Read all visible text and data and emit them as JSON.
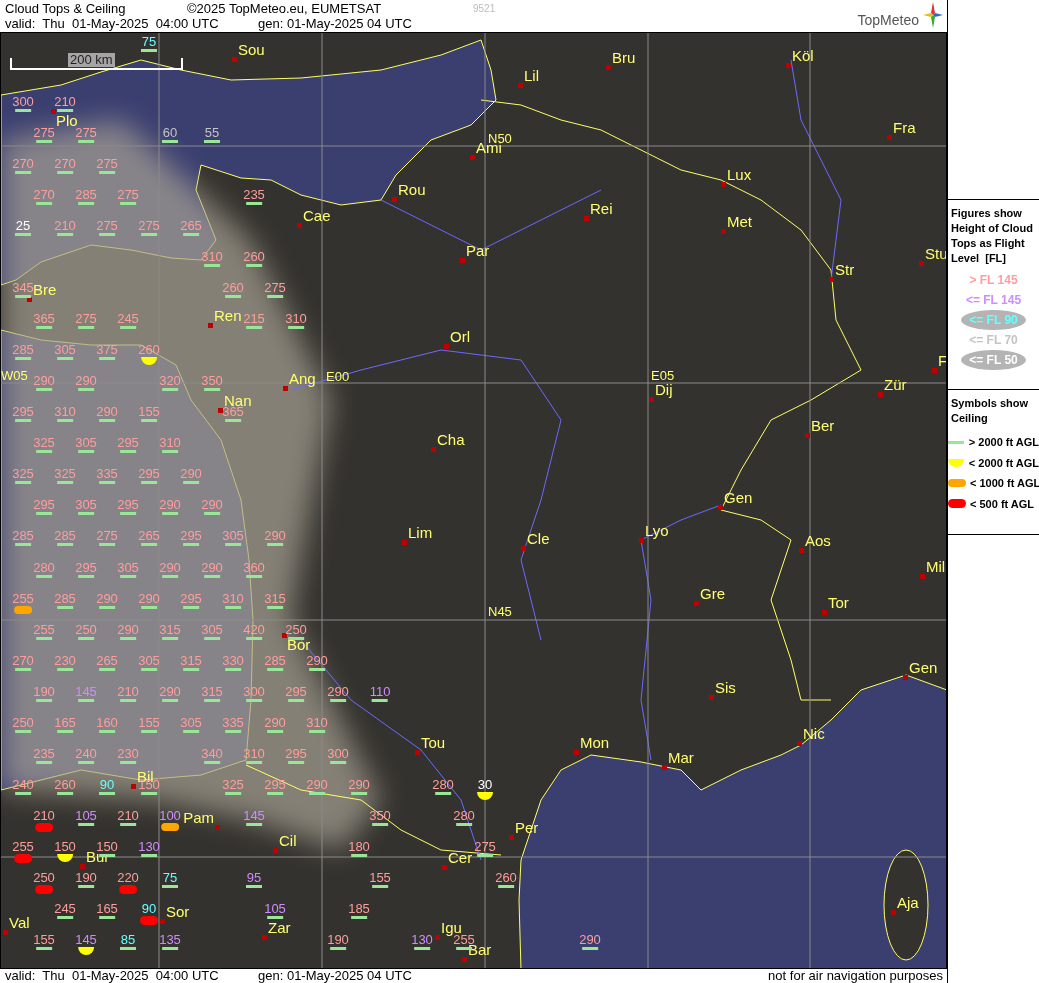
{
  "header": {
    "title": "Cloud Tops & Ceiling",
    "copyright": "©2025 TopMeteo.eu, EUMETSAT",
    "code": "9521",
    "valid": "valid:  Thu  01-May-2025  04:00 UTC",
    "generated": "gen: 01-May-2025 04 UTC"
  },
  "logo": {
    "text": "TopMeteo"
  },
  "map": {
    "scale": "200 km",
    "places": [
      {
        "name": "Sou",
        "kind": "city"
      },
      {
        "name": "Bru",
        "kind": "city"
      },
      {
        "name": "Köl",
        "kind": "city"
      },
      {
        "name": "Lil",
        "kind": "city"
      },
      {
        "name": "Plo",
        "kind": "city"
      },
      {
        "name": "N50",
        "kind": "graticule"
      },
      {
        "name": "Ami",
        "kind": "city"
      },
      {
        "name": "Fra",
        "kind": "city"
      },
      {
        "name": "Lux",
        "kind": "city"
      },
      {
        "name": "Rou",
        "kind": "city"
      },
      {
        "name": "Cae",
        "kind": "city"
      },
      {
        "name": "Rei",
        "kind": "city"
      },
      {
        "name": "Met",
        "kind": "city"
      },
      {
        "name": "Par",
        "kind": "city"
      },
      {
        "name": "Stu",
        "kind": "city"
      },
      {
        "name": "Str",
        "kind": "city"
      },
      {
        "name": "Bre",
        "kind": "city"
      },
      {
        "name": "Ren",
        "kind": "city"
      },
      {
        "name": "Orl",
        "kind": "city"
      },
      {
        "name": "F",
        "kind": "city"
      },
      {
        "name": "W05",
        "kind": "graticule"
      },
      {
        "name": "Ang",
        "kind": "city"
      },
      {
        "name": "E00",
        "kind": "graticule"
      },
      {
        "name": "E05",
        "kind": "graticule"
      },
      {
        "name": "Dij",
        "kind": "city"
      },
      {
        "name": "Zür",
        "kind": "city"
      },
      {
        "name": "Nan",
        "kind": "city"
      },
      {
        "name": "Ber",
        "kind": "city"
      },
      {
        "name": "Cha",
        "kind": "city"
      },
      {
        "name": "Gen",
        "kind": "city"
      },
      {
        "name": "Lim",
        "kind": "city"
      },
      {
        "name": "Lyo",
        "kind": "city"
      },
      {
        "name": "Cle",
        "kind": "city"
      },
      {
        "name": "Aos",
        "kind": "city"
      },
      {
        "name": "Mil",
        "kind": "city"
      },
      {
        "name": "Gre",
        "kind": "city"
      },
      {
        "name": "Tor",
        "kind": "city"
      },
      {
        "name": "N45",
        "kind": "graticule"
      },
      {
        "name": "Bor",
        "kind": "city"
      },
      {
        "name": "Gen",
        "kind": "city"
      },
      {
        "name": "Sis",
        "kind": "city"
      },
      {
        "name": "Nic",
        "kind": "city"
      },
      {
        "name": "Tou",
        "kind": "city"
      },
      {
        "name": "Mon",
        "kind": "city"
      },
      {
        "name": "Mar",
        "kind": "city"
      },
      {
        "name": "Bil",
        "kind": "city"
      },
      {
        "name": "Pam",
        "kind": "city"
      },
      {
        "name": "Per",
        "kind": "city"
      },
      {
        "name": "Cil",
        "kind": "city"
      },
      {
        "name": "Cer",
        "kind": "city"
      },
      {
        "name": "Bur",
        "kind": "city"
      },
      {
        "name": "Aja",
        "kind": "city"
      },
      {
        "name": "Sor",
        "kind": "city"
      },
      {
        "name": "Val",
        "kind": "city"
      },
      {
        "name": "Zar",
        "kind": "city"
      },
      {
        "name": "Igu",
        "kind": "city"
      },
      {
        "name": "Bar",
        "kind": "city"
      }
    ],
    "figures": [
      {
        "value": "75",
        "color": "#66ffff",
        "kind": "above2000"
      },
      {
        "value": "300",
        "color": "#ff9d9d",
        "kind": "above2000"
      },
      {
        "value": "210",
        "color": "#ff9d9d",
        "kind": "above2000"
      },
      {
        "value": "275",
        "color": "#ff9d9d",
        "kind": "above2000"
      },
      {
        "value": "275",
        "color": "#ff9d9d",
        "kind": "above2000"
      },
      {
        "value": "60",
        "color": "#c4c4c4",
        "kind": "above2000"
      },
      {
        "value": "55",
        "color": "#c4c4c4",
        "kind": "above2000"
      },
      {
        "value": "270",
        "color": "#ff9d9d",
        "kind": "above2000"
      },
      {
        "value": "270",
        "color": "#ff9d9d",
        "kind": "above2000"
      },
      {
        "value": "275",
        "color": "#ff9d9d",
        "kind": "above2000"
      },
      {
        "value": "270",
        "color": "#ff9d9d",
        "kind": "above2000"
      },
      {
        "value": "285",
        "color": "#ff9d9d",
        "kind": "above2000"
      },
      {
        "value": "275",
        "color": "#ff9d9d",
        "kind": "above2000"
      },
      {
        "value": "235",
        "color": "#ff9d9d",
        "kind": "above2000"
      },
      {
        "value": "25",
        "color": "#ffffff",
        "kind": "above2000"
      },
      {
        "value": "210",
        "color": "#ff9d9d",
        "kind": "above2000"
      },
      {
        "value": "275",
        "color": "#ff9d9d",
        "kind": "above2000"
      },
      {
        "value": "275",
        "color": "#ff9d9d",
        "kind": "above2000"
      },
      {
        "value": "265",
        "color": "#ff9d9d",
        "kind": "above2000"
      },
      {
        "value": "310",
        "color": "#ff9d9d",
        "kind": "above2000"
      },
      {
        "value": "260",
        "color": "#ff9d9d",
        "kind": "above2000"
      },
      {
        "value": "345",
        "color": "#ff9d9d",
        "kind": "above2000"
      },
      {
        "value": "260",
        "color": "#ff9d9d",
        "kind": "above2000"
      },
      {
        "value": "275",
        "color": "#ff9d9d",
        "kind": "above2000"
      },
      {
        "value": "365",
        "color": "#ff9d9d",
        "kind": "above2000"
      },
      {
        "value": "275",
        "color": "#ff9d9d",
        "kind": "above2000"
      },
      {
        "value": "245",
        "color": "#ff9d9d",
        "kind": "above2000"
      },
      {
        "value": "215",
        "color": "#ff9d9d",
        "kind": "above2000"
      },
      {
        "value": "310",
        "color": "#ff9d9d",
        "kind": "above2000"
      },
      {
        "value": "285",
        "color": "#ff9d9d",
        "kind": "above2000"
      },
      {
        "value": "305",
        "color": "#ff9d9d",
        "kind": "above2000"
      },
      {
        "value": "375",
        "color": "#ff9d9d",
        "kind": "above2000"
      },
      {
        "value": "260",
        "color": "#ff9d9d",
        "kind": "below2000"
      },
      {
        "value": "290",
        "color": "#ff9d9d",
        "kind": "above2000"
      },
      {
        "value": "290",
        "color": "#ff9d9d",
        "kind": "above2000"
      },
      {
        "value": "320",
        "color": "#ff9d9d",
        "kind": "above2000"
      },
      {
        "value": "350",
        "color": "#ff9d9d",
        "kind": "above2000"
      },
      {
        "value": "295",
        "color": "#ff9d9d",
        "kind": "above2000"
      },
      {
        "value": "310",
        "color": "#ff9d9d",
        "kind": "above2000"
      },
      {
        "value": "290",
        "color": "#ff9d9d",
        "kind": "above2000"
      },
      {
        "value": "155",
        "color": "#ff9d9d",
        "kind": "above2000"
      },
      {
        "value": "365",
        "color": "#ff9d9d",
        "kind": "above2000"
      },
      {
        "value": "325",
        "color": "#ff9d9d",
        "kind": "above2000"
      },
      {
        "value": "305",
        "color": "#ff9d9d",
        "kind": "above2000"
      },
      {
        "value": "295",
        "color": "#ff9d9d",
        "kind": "above2000"
      },
      {
        "value": "310",
        "color": "#ff9d9d",
        "kind": "above2000"
      },
      {
        "value": "325",
        "color": "#ff9d9d",
        "kind": "above2000"
      },
      {
        "value": "325",
        "color": "#ff9d9d",
        "kind": "above2000"
      },
      {
        "value": "335",
        "color": "#ff9d9d",
        "kind": "above2000"
      },
      {
        "value": "295",
        "color": "#ff9d9d",
        "kind": "above2000"
      },
      {
        "value": "290",
        "color": "#ff9d9d",
        "kind": "above2000"
      },
      {
        "value": "295",
        "color": "#ff9d9d",
        "kind": "above2000"
      },
      {
        "value": "305",
        "color": "#ff9d9d",
        "kind": "above2000"
      },
      {
        "value": "295",
        "color": "#ff9d9d",
        "kind": "above2000"
      },
      {
        "value": "290",
        "color": "#ff9d9d",
        "kind": "above2000"
      },
      {
        "value": "290",
        "color": "#ff9d9d",
        "kind": "above2000"
      },
      {
        "value": "285",
        "color": "#ff9d9d",
        "kind": "above2000"
      },
      {
        "value": "285",
        "color": "#ff9d9d",
        "kind": "above2000"
      },
      {
        "value": "275",
        "color": "#ff9d9d",
        "kind": "above2000"
      },
      {
        "value": "265",
        "color": "#ff9d9d",
        "kind": "above2000"
      },
      {
        "value": "295",
        "color": "#ff9d9d",
        "kind": "above2000"
      },
      {
        "value": "305",
        "color": "#ff9d9d",
        "kind": "above2000"
      },
      {
        "value": "290",
        "color": "#ff9d9d",
        "kind": "above2000"
      },
      {
        "value": "280",
        "color": "#ff9d9d",
        "kind": "above2000"
      },
      {
        "value": "295",
        "color": "#ff9d9d",
        "kind": "above2000"
      },
      {
        "value": "305",
        "color": "#ff9d9d",
        "kind": "above2000"
      },
      {
        "value": "290",
        "color": "#ff9d9d",
        "kind": "above2000"
      },
      {
        "value": "290",
        "color": "#ff9d9d",
        "kind": "above2000"
      },
      {
        "value": "360",
        "color": "#ff9d9d",
        "kind": "above2000"
      },
      {
        "value": "255",
        "color": "#ff9d9d",
        "kind": "below1000"
      },
      {
        "value": "285",
        "color": "#ff9d9d",
        "kind": "above2000"
      },
      {
        "value": "290",
        "color": "#ff9d9d",
        "kind": "above2000"
      },
      {
        "value": "290",
        "color": "#ff9d9d",
        "kind": "above2000"
      },
      {
        "value": "295",
        "color": "#ff9d9d",
        "kind": "above2000"
      },
      {
        "value": "310",
        "color": "#ff9d9d",
        "kind": "above2000"
      },
      {
        "value": "315",
        "color": "#ff9d9d",
        "kind": "above2000"
      },
      {
        "value": "255",
        "color": "#ff9d9d",
        "kind": "above2000"
      },
      {
        "value": "250",
        "color": "#ff9d9d",
        "kind": "above2000"
      },
      {
        "value": "290",
        "color": "#ff9d9d",
        "kind": "above2000"
      },
      {
        "value": "315",
        "color": "#ff9d9d",
        "kind": "above2000"
      },
      {
        "value": "305",
        "color": "#ff9d9d",
        "kind": "above2000"
      },
      {
        "value": "420",
        "color": "#ff9d9d",
        "kind": "above2000"
      },
      {
        "value": "250",
        "color": "#ff9d9d",
        "kind": "above2000"
      },
      {
        "value": "270",
        "color": "#ff9d9d",
        "kind": "above2000"
      },
      {
        "value": "230",
        "color": "#ff9d9d",
        "kind": "above2000"
      },
      {
        "value": "265",
        "color": "#ff9d9d",
        "kind": "above2000"
      },
      {
        "value": "305",
        "color": "#ff9d9d",
        "kind": "above2000"
      },
      {
        "value": "315",
        "color": "#ff9d9d",
        "kind": "above2000"
      },
      {
        "value": "330",
        "color": "#ff9d9d",
        "kind": "above2000"
      },
      {
        "value": "285",
        "color": "#ff9d9d",
        "kind": "above2000"
      },
      {
        "value": "290",
        "color": "#ff9d9d",
        "kind": "above2000"
      },
      {
        "value": "190",
        "color": "#ff9d9d",
        "kind": "above2000"
      },
      {
        "value": "145",
        "color": "#cf8cff",
        "kind": "above2000"
      },
      {
        "value": "210",
        "color": "#ff9d9d",
        "kind": "above2000"
      },
      {
        "value": "290",
        "color": "#ff9d9d",
        "kind": "above2000"
      },
      {
        "value": "315",
        "color": "#ff9d9d",
        "kind": "above2000"
      },
      {
        "value": "300",
        "color": "#ff9d9d",
        "kind": "above2000"
      },
      {
        "value": "295",
        "color": "#ff9d9d",
        "kind": "above2000"
      },
      {
        "value": "290",
        "color": "#ff9d9d",
        "kind": "above2000"
      },
      {
        "value": "110",
        "color": "#cf8cff",
        "kind": "above2000"
      },
      {
        "value": "250",
        "color": "#ff9d9d",
        "kind": "above2000"
      },
      {
        "value": "165",
        "color": "#ff9d9d",
        "kind": "above2000"
      },
      {
        "value": "160",
        "color": "#ff9d9d",
        "kind": "above2000"
      },
      {
        "value": "155",
        "color": "#ff9d9d",
        "kind": "above2000"
      },
      {
        "value": "305",
        "color": "#ff9d9d",
        "kind": "above2000"
      },
      {
        "value": "335",
        "color": "#ff9d9d",
        "kind": "above2000"
      },
      {
        "value": "290",
        "color": "#ff9d9d",
        "kind": "above2000"
      },
      {
        "value": "310",
        "color": "#ff9d9d",
        "kind": "above2000"
      },
      {
        "value": "235",
        "color": "#ff9d9d",
        "kind": "above2000"
      },
      {
        "value": "240",
        "color": "#ff9d9d",
        "kind": "above2000"
      },
      {
        "value": "230",
        "color": "#ff9d9d",
        "kind": "above2000"
      },
      {
        "value": "340",
        "color": "#ff9d9d",
        "kind": "above2000"
      },
      {
        "value": "310",
        "color": "#ff9d9d",
        "kind": "above2000"
      },
      {
        "value": "295",
        "color": "#ff9d9d",
        "kind": "above2000"
      },
      {
        "value": "300",
        "color": "#ff9d9d",
        "kind": "above2000"
      },
      {
        "value": "240",
        "color": "#ff9d9d",
        "kind": "above2000"
      },
      {
        "value": "260",
        "color": "#ff9d9d",
        "kind": "above2000"
      },
      {
        "value": "90",
        "color": "#66ffff",
        "kind": "above2000"
      },
      {
        "value": "150",
        "color": "#ff9d9d",
        "kind": "above2000"
      },
      {
        "value": "325",
        "color": "#ff9d9d",
        "kind": "above2000"
      },
      {
        "value": "295",
        "color": "#ff9d9d",
        "kind": "above2000"
      },
      {
        "value": "290",
        "color": "#ff9d9d",
        "kind": "above2000"
      },
      {
        "value": "290",
        "color": "#ff9d9d",
        "kind": "above2000"
      },
      {
        "value": "280",
        "color": "#ff9d9d",
        "kind": "above2000"
      },
      {
        "value": "30",
        "color": "#ffffff",
        "kind": "below2000"
      },
      {
        "value": "210",
        "color": "#ff9d9d",
        "kind": "below500"
      },
      {
        "value": "105",
        "color": "#cf8cff",
        "kind": "above2000"
      },
      {
        "value": "210",
        "color": "#ff9d9d",
        "kind": "above2000"
      },
      {
        "value": "100",
        "color": "#cf8cff",
        "kind": "below1000"
      },
      {
        "value": "145",
        "color": "#cf8cff",
        "kind": "above2000"
      },
      {
        "value": "350",
        "color": "#ff9d9d",
        "kind": "above2000"
      },
      {
        "value": "280",
        "color": "#ff9d9d",
        "kind": "above2000"
      },
      {
        "value": "255",
        "color": "#ff9d9d",
        "kind": "below500"
      },
      {
        "value": "150",
        "color": "#ff9d9d",
        "kind": "below2000"
      },
      {
        "value": "150",
        "color": "#ff9d9d",
        "kind": "above2000"
      },
      {
        "value": "130",
        "color": "#cf8cff",
        "kind": "above2000"
      },
      {
        "value": "180",
        "color": "#ff9d9d",
        "kind": "above2000"
      },
      {
        "value": "275",
        "color": "#ff9d9d",
        "kind": "above2000"
      },
      {
        "value": "250",
        "color": "#ff9d9d",
        "kind": "below500"
      },
      {
        "value": "190",
        "color": "#ff9d9d",
        "kind": "above2000"
      },
      {
        "value": "220",
        "color": "#ff9d9d",
        "kind": "below500"
      },
      {
        "value": "75",
        "color": "#66ffff",
        "kind": "above2000"
      },
      {
        "value": "95",
        "color": "#cf8cff",
        "kind": "above2000"
      },
      {
        "value": "155",
        "color": "#ff9d9d",
        "kind": "above2000"
      },
      {
        "value": "260",
        "color": "#ff9d9d",
        "kind": "above2000"
      },
      {
        "value": "245",
        "color": "#ff9d9d",
        "kind": "above2000"
      },
      {
        "value": "165",
        "color": "#ff9d9d",
        "kind": "above2000"
      },
      {
        "value": "90",
        "color": "#66ffff",
        "kind": "below500"
      },
      {
        "value": "105",
        "color": "#cf8cff",
        "kind": "above2000"
      },
      {
        "value": "185",
        "color": "#ff9d9d",
        "kind": "above2000"
      },
      {
        "value": "155",
        "color": "#ff9d9d",
        "kind": "above2000"
      },
      {
        "value": "145",
        "color": "#cf8cff",
        "kind": "below2000"
      },
      {
        "value": "85",
        "color": "#66ffff",
        "kind": "above2000"
      },
      {
        "value": "135",
        "color": "#cf8cff",
        "kind": "above2000"
      },
      {
        "value": "190",
        "color": "#ff9d9d",
        "kind": "above2000"
      },
      {
        "value": "130",
        "color": "#cf8cff",
        "kind": "above2000"
      },
      {
        "value": "255",
        "color": "#ff9d9d",
        "kind": "above2000"
      },
      {
        "value": "290",
        "color": "#ff9d9d",
        "kind": "above2000"
      }
    ]
  },
  "legend": {
    "figures_title": "Figures show Height of Cloud Tops as Flight Level  [FL]",
    "tiers": [
      {
        "label": "> FL 145",
        "color": "#ff9d9d",
        "ellipse": false
      },
      {
        "label": "<= FL 145",
        "color": "#cf8cff",
        "ellipse": false
      },
      {
        "label": "<= FL 90",
        "color": "#66ffff",
        "ellipse": true
      },
      {
        "label": "<= FL 70",
        "color": "#c4c4c4",
        "ellipse": false
      },
      {
        "label": "<= FL 50",
        "color": "#ffffff",
        "ellipse": true
      }
    ],
    "ceiling_title": "Symbols show Ceiling",
    "ceilings": [
      {
        "label": "> 2000 ft AGL",
        "kind": "above2000"
      },
      {
        "label": "< 2000 ft AGL",
        "kind": "below2000"
      },
      {
        "label": "< 1000 ft AGL",
        "kind": "below1000"
      },
      {
        "label": "< 500 ft AGL",
        "kind": "below500"
      }
    ]
  },
  "footer": {
    "valid": "valid:  Thu  01-May-2025  04:00 UTC",
    "generated": "gen: 01-May-2025 04 UTC",
    "disclaimer": "not for air navigation purposes"
  }
}
